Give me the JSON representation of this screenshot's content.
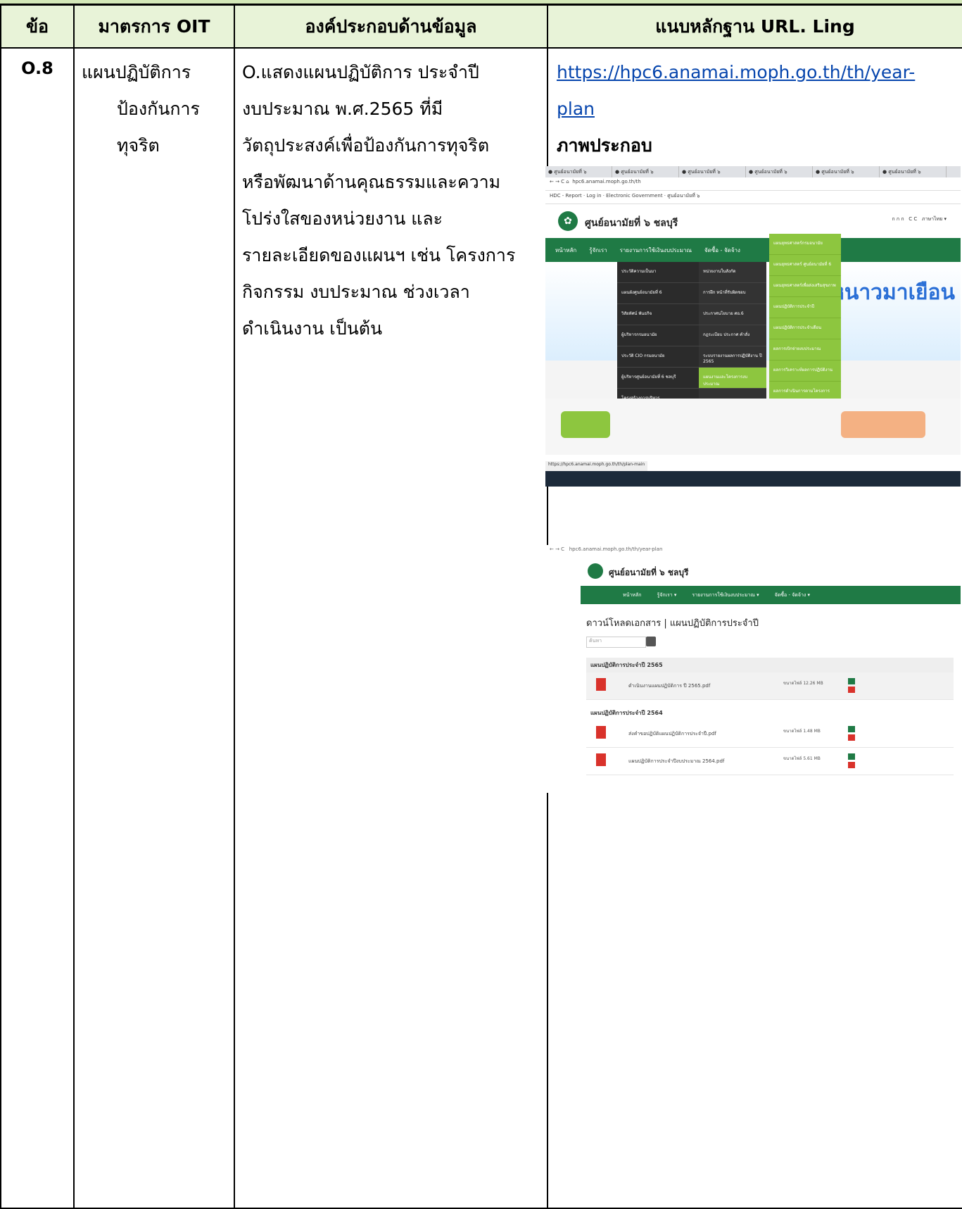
{
  "table": {
    "headers": [
      "ข้อ",
      "มาตรการ OIT",
      "องค์ประกอบด้านข้อมูล",
      "แนบหลักฐาน URL. Ling"
    ],
    "row": {
      "no": "O.8",
      "measure_line1": "แผนปฏิบัติการ",
      "measure_line2": "ป้องกันการ",
      "measure_line3": "ทุจริต",
      "element_lines": [
        "O.แสดงแผนปฏิบัติการ ประจำปี",
        "งบประมาณ พ.ศ.2565 ที่มี",
        "วัตถุประสงค์เพื่อป้องกันการทุจริต",
        "หรือพัฒนาด้านคุณธรรมและความ",
        "โปร่งใสของหน่วยงาน และ",
        "รายละเอียดของแผนฯ เช่น โครงการ",
        "กิจกรรม งบประมาณ ช่วงเวลา",
        "ดำเนินงาน  เป็นต้น"
      ],
      "url_line1": "https://hpc6.anamai.moph.go.th/th/year-",
      "url_line2": "plan",
      "figure_label": "ภาพประกอบ"
    }
  },
  "screenshot1": {
    "site_name": "ศูนย์อนามัยที่ ๖ ชลบุรี",
    "address": "hpc6.anamai.moph.go.th/th",
    "banner_text": "หนาวมาเยือน",
    "nav_items": [
      "หน้าหลัก",
      "รู้จักเรา",
      "รายงานการใช้เงินงบประมาณ",
      "จัดซื้อ - จัดจ้าง"
    ],
    "status_url": "https://hpc6.anamai.moph.go.th/th/plan-main"
  },
  "screenshot2": {
    "site_name": "ศูนย์อนามัยที่ ๖ ชลบุรี",
    "address": "hpc6.anamai.moph.go.th/th/year-plan",
    "page_title": "ดาวน์โหลดเอกสาร | แผนปฏิบัติการประจำปี",
    "search_placeholder": "ค้นหา",
    "group1_title": "แผนปฏิบัติการประจำปี 2565",
    "group1_file": "ดำเนินงานแผนปฏิบัติการ ปี 2565.pdf",
    "group2_title": "แผนปฏิบัติการประจำปี 2564",
    "group2_file1": "ส่งคำขอปฏิบัติแผนปฏิบัติการประจำปี.pdf",
    "group2_file2": "แผนปฏิบัติการประจำปีงบประมาณ 2564.pdf"
  },
  "colors": {
    "header_bg": "#e8f3d8",
    "top_band": "#d4e8b8",
    "link": "#0645ad",
    "site_green": "#1f7a45"
  }
}
